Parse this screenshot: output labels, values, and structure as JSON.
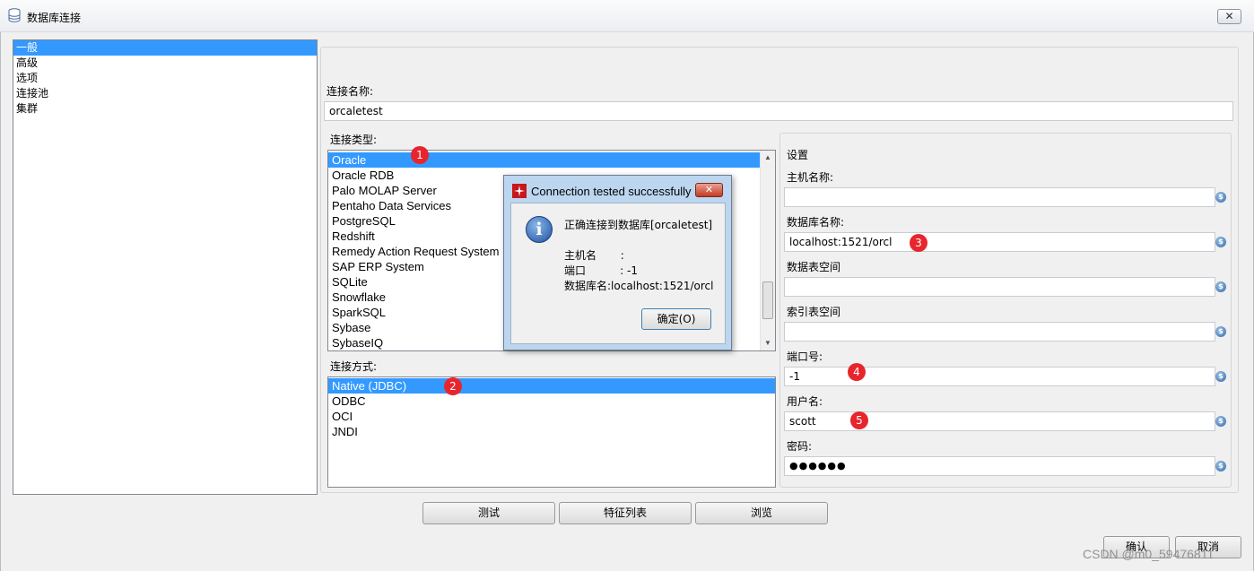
{
  "window": {
    "title": "数据库连接",
    "close_label": "✕"
  },
  "nav": {
    "items": [
      "一般",
      "高级",
      "选项",
      "连接池",
      "集群"
    ],
    "selected": "一般"
  },
  "connection_name": {
    "label": "连接名称:",
    "value": "orcaletest"
  },
  "connection_type": {
    "label": "连接类型:",
    "items": [
      "Oracle",
      "Oracle RDB",
      "Palo MOLAP Server",
      "Pentaho Data Services",
      "PostgreSQL",
      "Redshift",
      "Remedy Action Request System",
      "SAP ERP System",
      "SQLite",
      "Snowflake",
      "SparkSQL",
      "Sybase",
      "SybaseIQ"
    ],
    "selected": "Oracle"
  },
  "access_method": {
    "label": "连接方式:",
    "items": [
      "Native (JDBC)",
      "ODBC",
      "OCI",
      "JNDI"
    ],
    "selected": "Native (JDBC)"
  },
  "settings": {
    "title": "设置",
    "host": {
      "label": "主机名称:",
      "value": ""
    },
    "database": {
      "label": "数据库名称:",
      "value": "localhost:1521/orcl"
    },
    "tablespace": {
      "label": "数据表空间",
      "value": ""
    },
    "index_tablespace": {
      "label": "索引表空间",
      "value": ""
    },
    "port": {
      "label": "端口号:",
      "value": "-1"
    },
    "username": {
      "label": "用户名:",
      "value": "scott"
    },
    "password": {
      "label": "密码:",
      "value": "●●●●●●"
    }
  },
  "badges": [
    "1",
    "2",
    "3",
    "4",
    "5"
  ],
  "buttons": {
    "test": "测试",
    "features": "特征列表",
    "explore": "浏览",
    "ok": "确认",
    "cancel": "取消"
  },
  "dialog": {
    "title": "Connection tested successfully",
    "close_label": "✕",
    "message": "正确连接到数据库[orcaletest]",
    "host_line": "主机名       :",
    "port_line": "端口          : -1",
    "db_line": "数据库名:localhost:1521/orcl",
    "ok_label": "确定(O)"
  },
  "watermark": "CSDN @m0_59476811",
  "colors": {
    "selection": "#3399ff",
    "badge": "#e8252d",
    "dialog_frame": "#bcd6ef"
  }
}
